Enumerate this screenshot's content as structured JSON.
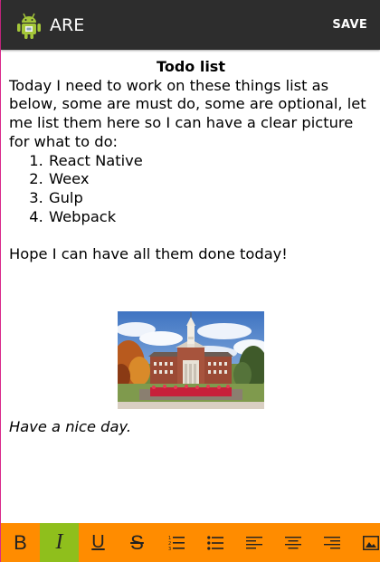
{
  "action_bar": {
    "title": "ARE",
    "save_label": "SAVE",
    "app_icon": "android-icon"
  },
  "document": {
    "title": "Todo list",
    "intro": "Today I need to work on these things list as below, some are must do, some are optional, let me list them here so I can have a clear picture for what to do:",
    "items": [
      "React Native",
      "Weex",
      "Gulp",
      "Webpack"
    ],
    "closing": "Hope I can have all them done today!",
    "image": "university-building-photo",
    "sign_off": "Have a nice day."
  },
  "toolbar": {
    "bold_label": "B",
    "italic_label": "I",
    "underline_label": "U",
    "strike_label": "S",
    "active": "italic",
    "colors": {
      "background": "#ff8c00",
      "active": "#8fbf1c"
    },
    "icons": [
      "bold",
      "italic",
      "underline",
      "strikethrough",
      "numbered-list-icon",
      "bullet-list-icon",
      "align-left-icon",
      "align-center-icon",
      "align-right-icon",
      "insert-image-icon"
    ]
  },
  "colors": {
    "action_bar": "#2d2d2d",
    "android_green": "#a4c639"
  }
}
